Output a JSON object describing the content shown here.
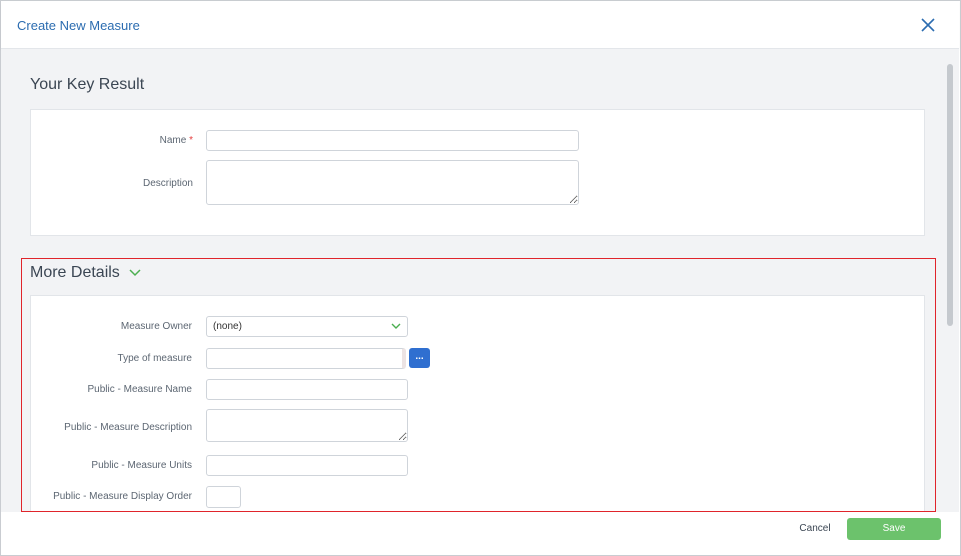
{
  "dialog": {
    "title": "Create New Measure"
  },
  "key_result": {
    "heading": "Your Key Result",
    "fields": {
      "name_label": "Name",
      "required_marker": "*",
      "description_label": "Description"
    }
  },
  "more_details": {
    "heading": "More Details",
    "fields": {
      "measure_owner_label": "Measure Owner",
      "measure_owner_value": "(none)",
      "type_of_measure_label": "Type of measure",
      "browse_button_label": "...",
      "public_name_label": "Public - Measure Name",
      "public_description_label": "Public - Measure Description",
      "public_units_label": "Public - Measure Units",
      "public_display_order_label": "Public - Measure Display Order"
    }
  },
  "footer": {
    "cancel_label": "Cancel",
    "save_label": "Save"
  },
  "colors": {
    "accent_blue": "#2b6cb0",
    "save_green": "#6cc26c",
    "highlight_red": "#e0242b",
    "chevron_green": "#4caf50"
  },
  "icons": {
    "close": "close-icon",
    "more_details_toggle": "chevron-down-icon",
    "select_caret": "chevron-down-icon"
  }
}
